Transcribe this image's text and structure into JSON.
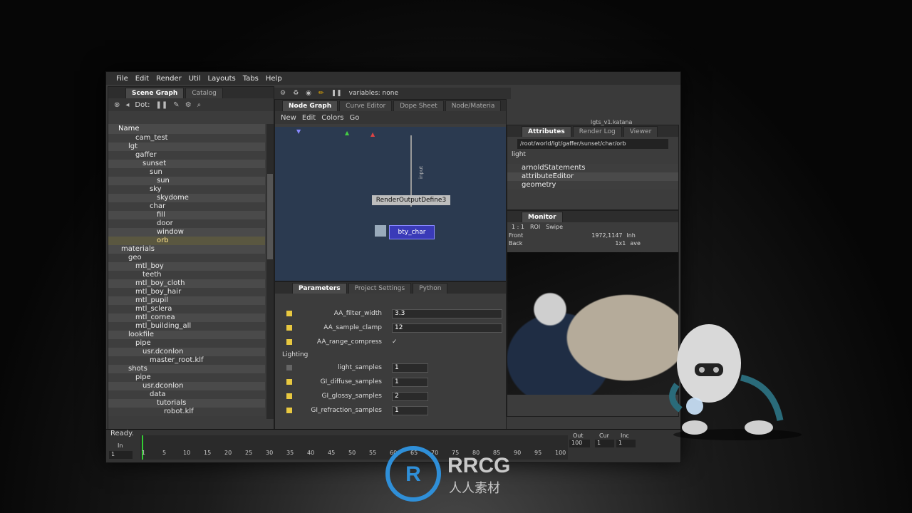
{
  "menu": [
    "File",
    "Edit",
    "Render",
    "Util",
    "Layouts",
    "Tabs",
    "Help"
  ],
  "scene": {
    "tabs": [
      "Scene Graph",
      "Catalog"
    ],
    "toolbar_label": "Dot:",
    "col_header": "Name",
    "items": [
      "cam_test",
      "lgt",
      "gaffer",
      "sunset",
      "sun",
      "sun",
      "sky",
      "skydome",
      "char",
      "fill",
      "door",
      "window",
      "orb",
      "materials",
      "geo",
      "mtl_boy",
      "teeth",
      "mtl_boy_cloth",
      "mtl_boy_hair",
      "mtl_pupil",
      "mtl_sclera",
      "mtl_cornea",
      "mtl_building_all",
      "lookfile",
      "pipe",
      "usr.dconlon",
      "master_root.klf",
      "shots",
      "pipe",
      "usr.dconlon",
      "data",
      "tutorials",
      "robot.klf"
    ]
  },
  "nodegraph": {
    "tabs": [
      "Node Graph",
      "Curve Editor",
      "Dope Sheet",
      "Node/Materia"
    ],
    "menu": [
      "New",
      "Edit",
      "Colors",
      "Go"
    ],
    "variables": "variables: none",
    "node1": "RenderOutputDefine3",
    "node2": "bty_char",
    "wire_label": "input"
  },
  "attributes": {
    "tabs": [
      "Attributes",
      "Render Log",
      "Viewer"
    ],
    "file": "lgts_v1.katana",
    "path": "/root/world/lgt/gaffer/sunset/char/orb",
    "section": "light",
    "groups": [
      "arnoldStatements",
      "attributeEditor",
      "geometry"
    ]
  },
  "monitor": {
    "tab": "Monitor",
    "front_label": "Front",
    "back_label": "Back",
    "coord": "1972,1147",
    "scale": "1x1",
    "mode1": "lnh",
    "mode2": "ave",
    "roi": "ROI",
    "swipe": "Swipe",
    "ratio": "1 : 1"
  },
  "params": {
    "tabs": [
      "Parameters",
      "Project Settings",
      "Python"
    ],
    "rows": [
      {
        "label": "AA_filter_width",
        "value": "3.3"
      },
      {
        "label": "AA_sample_clamp",
        "value": "12"
      },
      {
        "label": "AA_range_compress",
        "value": "✓"
      }
    ],
    "section": "Lighting",
    "lighting": [
      {
        "label": "light_samples",
        "value": "1"
      },
      {
        "label": "GI_diffuse_samples",
        "value": "1"
      },
      {
        "label": "GI_glossy_samples",
        "value": "2"
      },
      {
        "label": "GI_refraction_samples",
        "value": "1"
      }
    ]
  },
  "status": "Ready.",
  "timeline": {
    "in_label": "In",
    "in_value": "1",
    "out_label": "Out",
    "out_value": "100",
    "cur_label": "Cur",
    "cur_value": "1",
    "inc_label": "Inc",
    "inc_value": "1",
    "ticks": [
      "1",
      "5",
      "10",
      "15",
      "20",
      "25",
      "30",
      "35",
      "40",
      "45",
      "50",
      "55",
      "60",
      "65",
      "70",
      "75",
      "80",
      "85",
      "90",
      "95",
      "100"
    ]
  },
  "logo": {
    "main": "RRCG",
    "sub": "人人素材"
  }
}
